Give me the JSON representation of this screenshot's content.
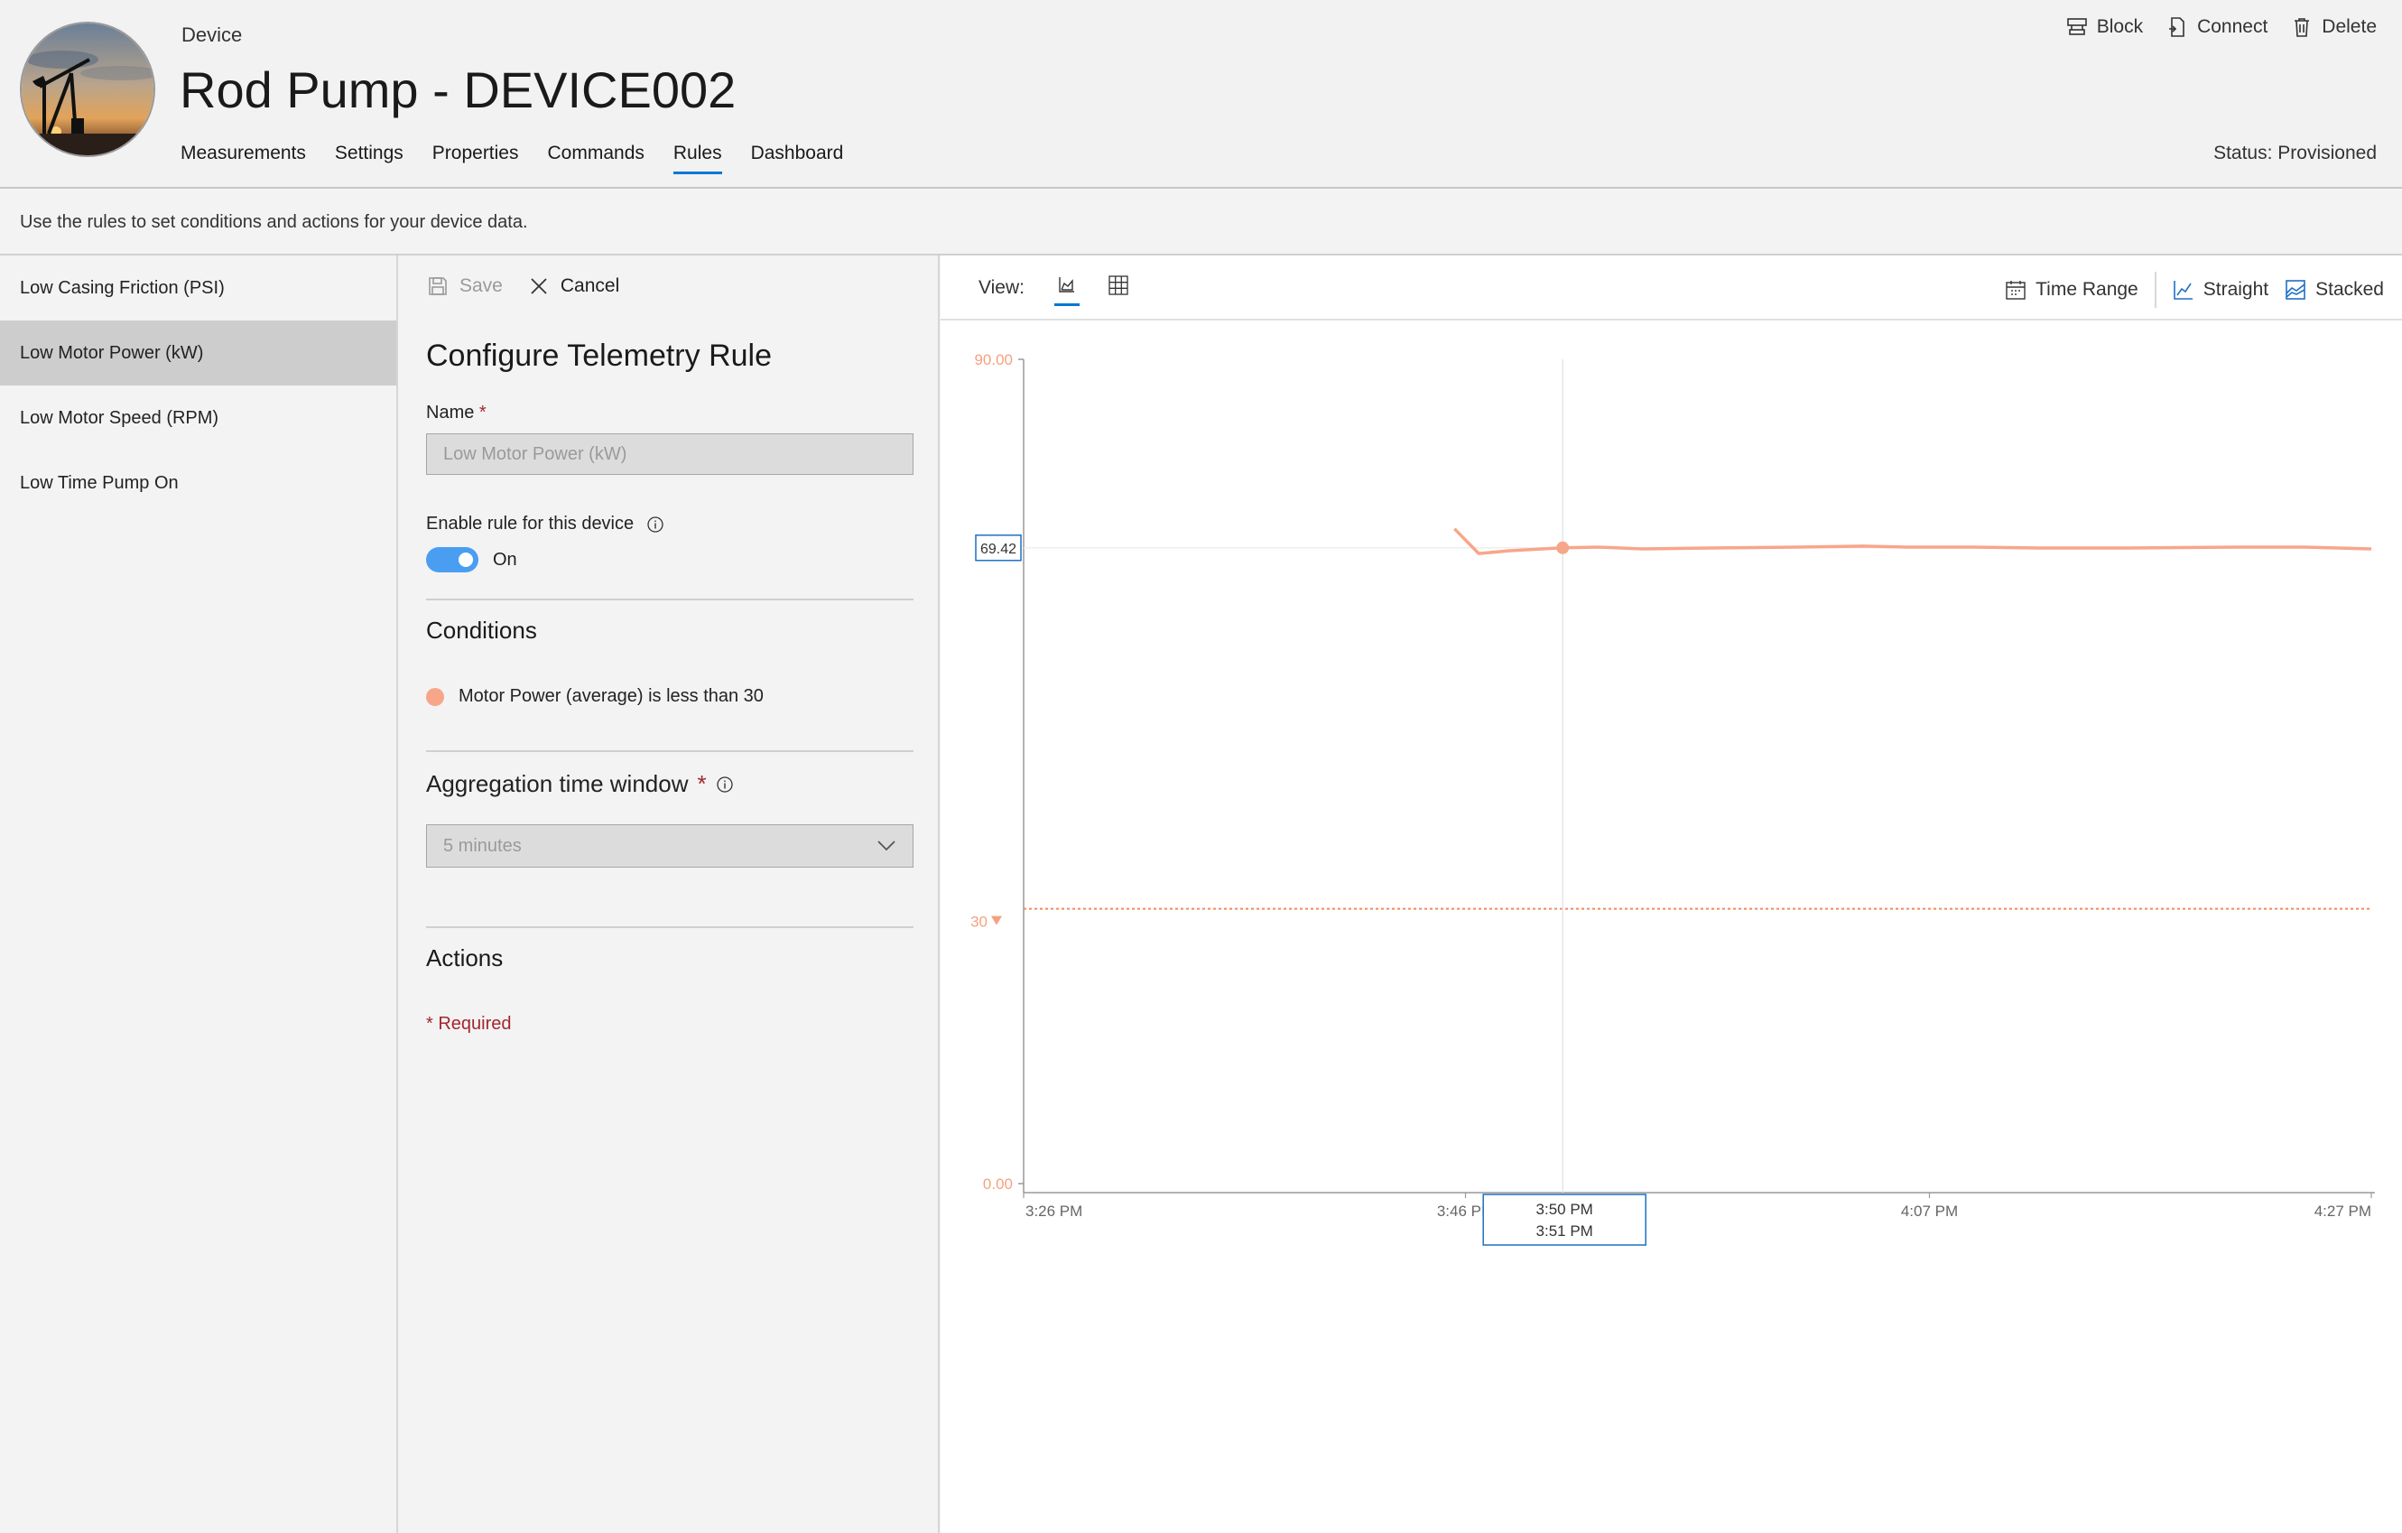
{
  "header": {
    "kind_label": "Device",
    "title": "Rod Pump - DEVICE002",
    "tabs": [
      {
        "label": "Measurements"
      },
      {
        "label": "Settings"
      },
      {
        "label": "Properties"
      },
      {
        "label": "Commands"
      },
      {
        "label": "Rules"
      },
      {
        "label": "Dashboard"
      }
    ],
    "active_tab": "Rules",
    "actions": {
      "block": "Block",
      "connect": "Connect",
      "delete": "Delete"
    },
    "status": "Status: Provisioned"
  },
  "description": "Use the rules to set conditions and actions for your device data.",
  "rules": [
    {
      "label": "Low Casing Friction (PSI)"
    },
    {
      "label": "Low Motor Power (kW)"
    },
    {
      "label": "Low Motor Speed (RPM)"
    },
    {
      "label": "Low Time Pump On"
    }
  ],
  "selected_rule": "Low Motor Power (kW)",
  "config": {
    "save_label": "Save",
    "cancel_label": "Cancel",
    "title": "Configure Telemetry Rule",
    "name_label": "Name",
    "required_star": "*",
    "name_value": "Low Motor Power (kW)",
    "enable_label": "Enable rule for this device",
    "toggle_state": "On",
    "conditions_heading": "Conditions",
    "condition_text": "Motor Power (average) is less than 30",
    "aggregation_label": "Aggregation time window",
    "aggregation_value": "5 minutes",
    "actions_heading": "Actions",
    "required_note": "* Required"
  },
  "chart_toolbar": {
    "view_label": "View:",
    "time_range": "Time Range",
    "straight": "Straight",
    "stacked": "Stacked"
  },
  "colors": {
    "series": "#f7a68a",
    "accent": "#0078d4",
    "threshold": "#f08a5d"
  },
  "chart_data": {
    "type": "line",
    "ylim": [
      0,
      90
    ],
    "y_tick_labels": [
      "90.00",
      "0.00"
    ],
    "x_tick_labels": [
      "3:26 PM",
      "3:46 PM",
      "4:07 PM",
      "4:27 PM"
    ],
    "x_ticks_min": [
      0,
      20,
      41,
      61
    ],
    "threshold": {
      "value": 30,
      "label": "30"
    },
    "hover": {
      "value_label": "69.42",
      "time_from": "3:50 PM",
      "time_to": "3:51 PM",
      "x_min": 24.4,
      "y": 69.42
    },
    "series": [
      {
        "x_min": [
          19.5,
          20.6,
          22,
          24.4,
          26,
          28,
          31,
          35,
          38,
          40,
          43,
          46,
          50,
          55,
          58,
          61
        ],
        "y": [
          71.5,
          68.8,
          69.1,
          69.42,
          69.5,
          69.3,
          69.4,
          69.5,
          69.6,
          69.5,
          69.5,
          69.4,
          69.4,
          69.5,
          69.5,
          69.3
        ]
      }
    ]
  }
}
